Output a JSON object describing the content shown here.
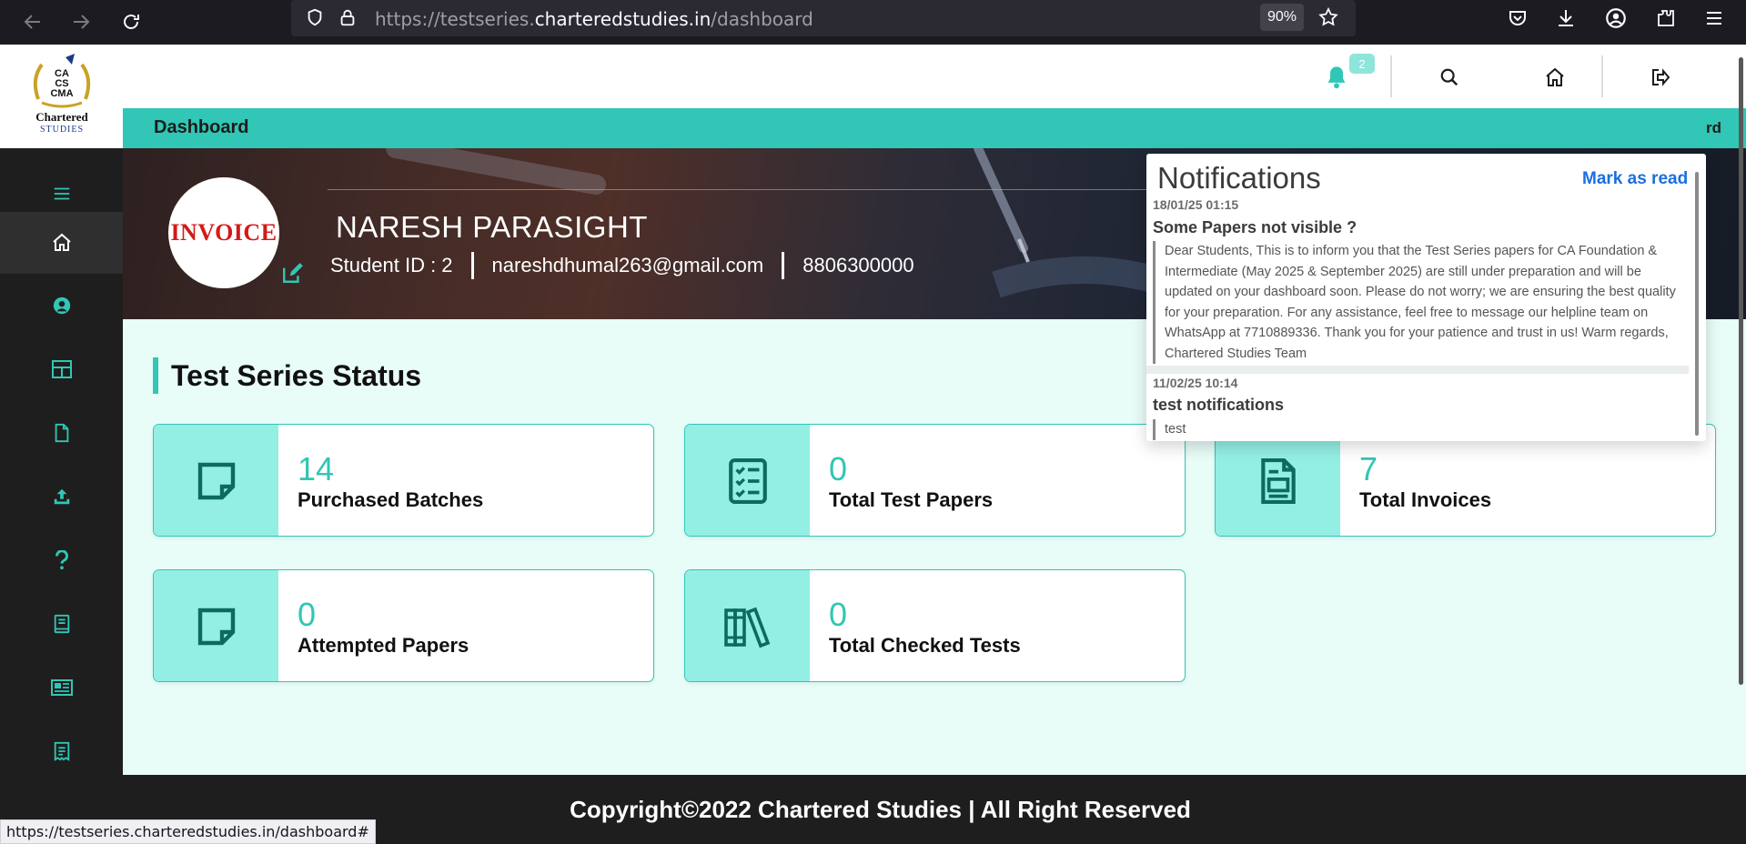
{
  "browser": {
    "url_prefix": "https://testseries.",
    "url_domain": "charteredstudies.in",
    "url_path": "/dashboard",
    "zoom": "90%",
    "status_url": "https://testseries.charteredstudies.in/dashboard#"
  },
  "logo": {
    "line1": "Chartered",
    "line2": "STUDIES",
    "crest": [
      "CA",
      "CS",
      "CMA"
    ]
  },
  "sidebar": {
    "items": [
      {
        "icon": "menu-icon"
      },
      {
        "icon": "home-icon"
      },
      {
        "icon": "user-icon"
      },
      {
        "icon": "grid-icon"
      },
      {
        "icon": "file-icon"
      },
      {
        "icon": "upload-icon"
      },
      {
        "icon": "help-icon"
      },
      {
        "icon": "book-icon"
      },
      {
        "icon": "newspaper-icon"
      },
      {
        "icon": "receipt-icon"
      }
    ]
  },
  "header": {
    "bell_count": "2"
  },
  "title_strip": {
    "title": "Dashboard",
    "right_fragment": "rd"
  },
  "profile": {
    "avatar_text": "INVOICE",
    "name": "NARESH PARASIGHT",
    "student_id": "Student ID : 2",
    "email": "nareshdhumal263@gmail.com",
    "phone": "8806300000"
  },
  "section": {
    "title": "Test Series Status"
  },
  "cards": [
    {
      "value": "14",
      "label": "Purchased Batches",
      "icon": "sticky-note-icon"
    },
    {
      "value": "0",
      "label": "Total Test Papers",
      "icon": "checklist-icon"
    },
    {
      "value": "7",
      "label": "Total Invoices",
      "icon": "invoice-icon"
    },
    {
      "value": "0",
      "label": "Attempted Papers",
      "icon": "sticky-note-icon"
    },
    {
      "value": "0",
      "label": "Total Checked Tests",
      "icon": "books-icon"
    }
  ],
  "footer": {
    "text": "Copyright©2022 Chartered Studies | All Right Reserved"
  },
  "notifications": {
    "title": "Notifications",
    "mark_read": "Mark as read",
    "items": [
      {
        "date": "18/01/25 01:15",
        "title": "Some Papers not visible ?",
        "body": "Dear Students, This is to inform you that the Test Series papers for CA Foundation & Intermediate (May 2025 & September 2025) are still under preparation and will be updated on your dashboard soon. Please do not worry; we are ensuring the best quality for your preparation. For any assistance, feel free to message our helpline team on WhatsApp at 7710889336. Thank you for your patience and trust in us! Warm regards, Chartered Studies Team"
      },
      {
        "date": "11/02/25 10:14",
        "title": "test notifications",
        "body": "test"
      }
    ]
  },
  "colors": {
    "accent": "#31c6b5",
    "icon_bg": "#93efe4",
    "sidebar": "#1e1e1e",
    "page_bg": "#e8fcf8",
    "link": "#1b6fe0"
  }
}
